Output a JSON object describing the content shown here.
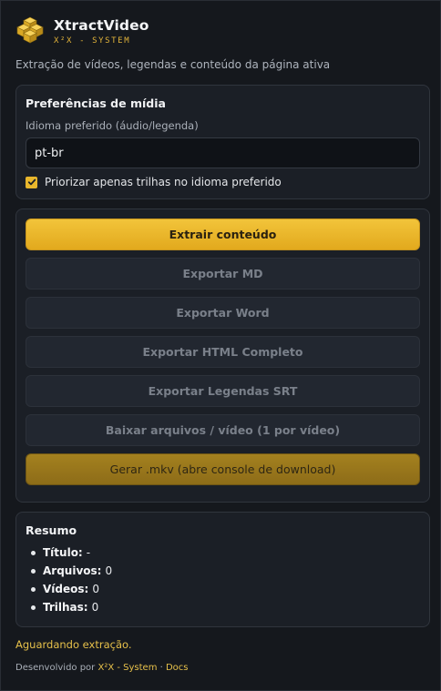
{
  "app": {
    "name": "XtractVideo",
    "subtitle": "X²X - SYSTEM",
    "tagline": "Extração de vídeos, legendas e conteúdo da página ativa"
  },
  "preferences": {
    "title": "Preferências de mídia",
    "language_label": "Idioma preferido (áudio/legenda)",
    "language_value": "pt-br",
    "prioritize_label": "Priorizar apenas trilhas no idioma preferido",
    "prioritize_checked": true
  },
  "actions": {
    "extract": "Extrair conteúdo",
    "export_md": "Exportar MD",
    "export_word": "Exportar Word",
    "export_html": "Exportar HTML Completo",
    "export_srt": "Exportar Legendas SRT",
    "download_files": "Baixar arquivos / vídeo (1 por vídeo)",
    "generate_mkv": "Gerar .mkv (abre console de download)"
  },
  "summary": {
    "title": "Resumo",
    "items": [
      {
        "label": "Título:",
        "value": "-"
      },
      {
        "label": "Arquivos:",
        "value": "0"
      },
      {
        "label": "Vídeos:",
        "value": "0"
      },
      {
        "label": "Trilhas:",
        "value": "0"
      }
    ]
  },
  "status": "Aguardando extração.",
  "footer": {
    "prefix": "Desenvolvido por ",
    "link_system": "X²X - System",
    "separator": " · ",
    "link_docs": "Docs"
  },
  "colors": {
    "accent": "#e8b62c",
    "background": "#15181d",
    "card": "#1b1f26"
  }
}
